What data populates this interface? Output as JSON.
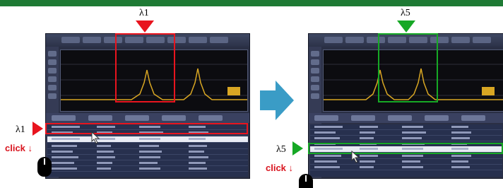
{
  "left_panel": {
    "lambda_top": "λ1",
    "lambda_side": "λ1",
    "click_label": "click",
    "click_arrow": "↓",
    "marker_color": "#e8141e"
  },
  "right_panel": {
    "lambda_top": "λ5",
    "lambda_side": "λ5",
    "click_label": "click",
    "click_arrow": "↓",
    "marker_color": "#16a825"
  },
  "colors": {
    "top_bar": "#1e7a34",
    "transition_arrow": "#3a9cc6",
    "click_text": "#d9141e"
  },
  "icons": {
    "transition_arrow": "right-arrow-icon",
    "mouse": "mouse-icon",
    "pointer": "cursor-pointer-icon"
  }
}
